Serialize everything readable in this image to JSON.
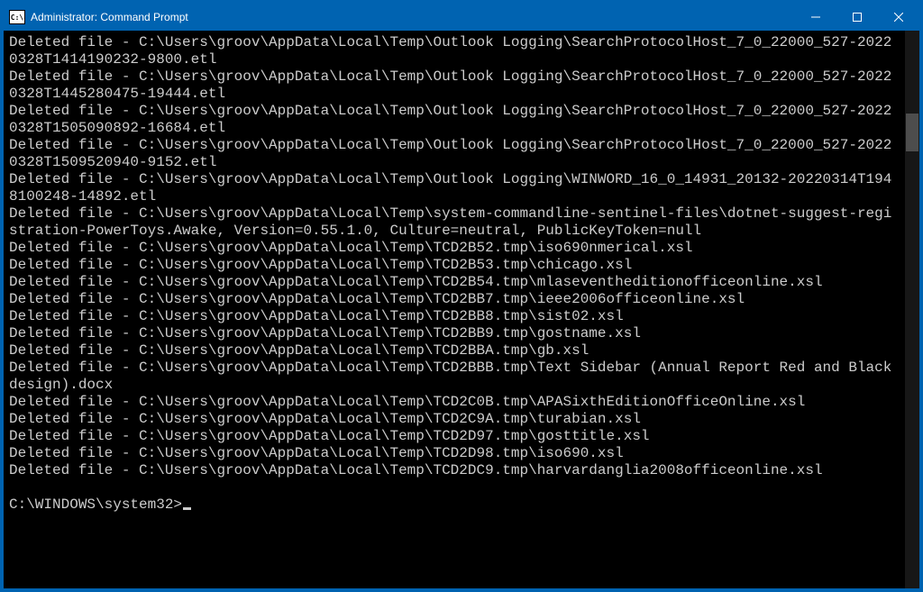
{
  "titlebar": {
    "icon_text": "C:\\",
    "title": "Administrator: Command Prompt"
  },
  "terminal": {
    "lines": [
      "Deleted file - C:\\Users\\groov\\AppData\\Local\\Temp\\Outlook Logging\\SearchProtocolHost_7_0_22000_527-20220328T1414190232-9800.etl",
      "Deleted file - C:\\Users\\groov\\AppData\\Local\\Temp\\Outlook Logging\\SearchProtocolHost_7_0_22000_527-20220328T1445280475-19444.etl",
      "Deleted file - C:\\Users\\groov\\AppData\\Local\\Temp\\Outlook Logging\\SearchProtocolHost_7_0_22000_527-20220328T1505090892-16684.etl",
      "Deleted file - C:\\Users\\groov\\AppData\\Local\\Temp\\Outlook Logging\\SearchProtocolHost_7_0_22000_527-20220328T1509520940-9152.etl",
      "Deleted file - C:\\Users\\groov\\AppData\\Local\\Temp\\Outlook Logging\\WINWORD_16_0_14931_20132-20220314T1948100248-14892.etl",
      "Deleted file - C:\\Users\\groov\\AppData\\Local\\Temp\\system-commandline-sentinel-files\\dotnet-suggest-registration-PowerToys.Awake, Version=0.55.1.0, Culture=neutral, PublicKeyToken=null",
      "Deleted file - C:\\Users\\groov\\AppData\\Local\\Temp\\TCD2B52.tmp\\iso690nmerical.xsl",
      "Deleted file - C:\\Users\\groov\\AppData\\Local\\Temp\\TCD2B53.tmp\\chicago.xsl",
      "Deleted file - C:\\Users\\groov\\AppData\\Local\\Temp\\TCD2B54.tmp\\mlaseventheditionofficeonline.xsl",
      "Deleted file - C:\\Users\\groov\\AppData\\Local\\Temp\\TCD2BB7.tmp\\ieee2006officeonline.xsl",
      "Deleted file - C:\\Users\\groov\\AppData\\Local\\Temp\\TCD2BB8.tmp\\sist02.xsl",
      "Deleted file - C:\\Users\\groov\\AppData\\Local\\Temp\\TCD2BB9.tmp\\gostname.xsl",
      "Deleted file - C:\\Users\\groov\\AppData\\Local\\Temp\\TCD2BBA.tmp\\gb.xsl",
      "Deleted file - C:\\Users\\groov\\AppData\\Local\\Temp\\TCD2BBB.tmp\\Text Sidebar (Annual Report Red and Black design).docx",
      "Deleted file - C:\\Users\\groov\\AppData\\Local\\Temp\\TCD2C0B.tmp\\APASixthEditionOfficeOnline.xsl",
      "Deleted file - C:\\Users\\groov\\AppData\\Local\\Temp\\TCD2C9A.tmp\\turabian.xsl",
      "Deleted file - C:\\Users\\groov\\AppData\\Local\\Temp\\TCD2D97.tmp\\gosttitle.xsl",
      "Deleted file - C:\\Users\\groov\\AppData\\Local\\Temp\\TCD2D98.tmp\\iso690.xsl",
      "Deleted file - C:\\Users\\groov\\AppData\\Local\\Temp\\TCD2DC9.tmp\\harvardanglia2008officeonline.xsl"
    ],
    "prompt": "C:\\WINDOWS\\system32>"
  }
}
